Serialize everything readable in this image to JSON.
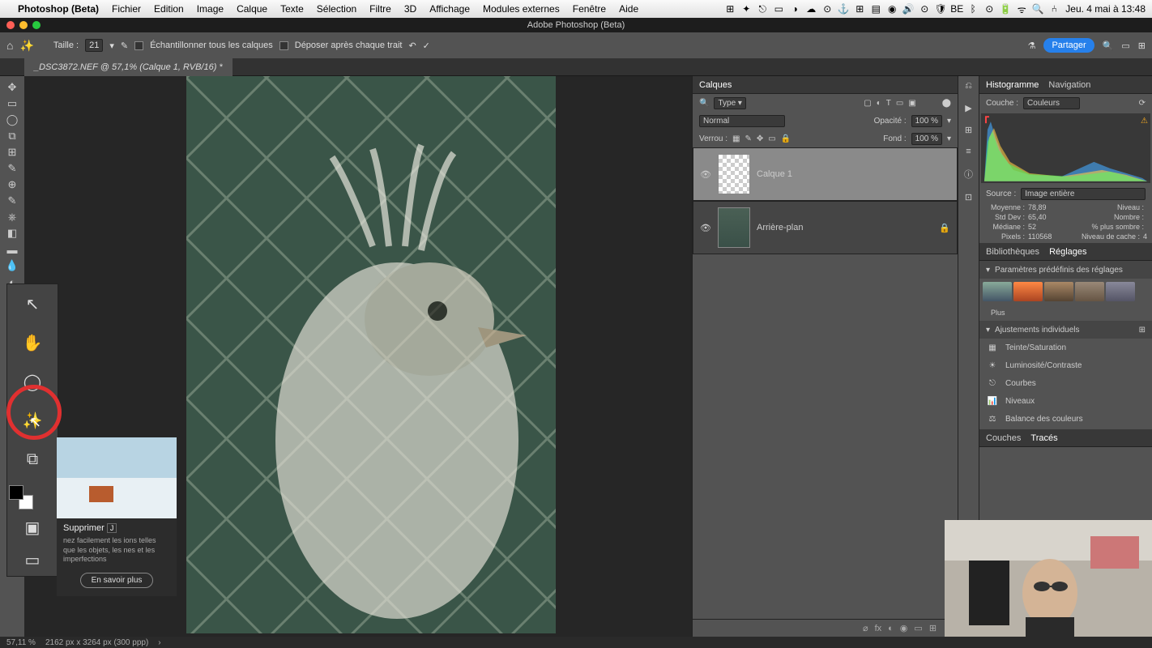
{
  "macmenu": {
    "app": "Photoshop (Beta)",
    "items": [
      "Fichier",
      "Edition",
      "Image",
      "Calque",
      "Texte",
      "Sélection",
      "Filtre",
      "3D",
      "Affichage",
      "Modules externes",
      "Fenêtre",
      "Aide"
    ],
    "clock": "Jeu. 4 mai à 13:48"
  },
  "titlebar": "Adobe Photoshop (Beta)",
  "optbar": {
    "size_label": "Taille :",
    "size_val": "21",
    "sample_label": "Échantillonner tous les calques",
    "drop_label": "Déposer après chaque trait",
    "share": "Partager"
  },
  "doc_tab": "_DSC3872.NEF @ 57,1% (Calque 1, RVB/16) *",
  "layers_panel": {
    "tab": "Calques",
    "filter_label": "Type",
    "blend": "Normal",
    "opacity_label": "Opacité :",
    "opacity_val": "100 %",
    "lock_label": "Verrou :",
    "fill_label": "Fond :",
    "fill_val": "100 %",
    "layers": [
      {
        "name": "Calque 1",
        "visible": true,
        "selected": true,
        "checker": true
      },
      {
        "name": "Arrière-plan",
        "visible": true,
        "selected": false,
        "locked": true
      }
    ]
  },
  "hist_panel": {
    "tabs": [
      "Histogramme",
      "Navigation"
    ],
    "channel_label": "Couche :",
    "channel_val": "Couleurs",
    "source_label": "Source :",
    "source_val": "Image entière",
    "stats": {
      "moyenne_l": "Moyenne :",
      "moyenne": "78,89",
      "stddev_l": "Std Dev :",
      "stddev": "65,40",
      "mediane_l": "Médiane :",
      "mediane": "52",
      "pixels_l": "Pixels :",
      "pixels": "110568",
      "niveau_l": "Niveau :",
      "nombre_l": "Nombre :",
      "sombre_l": "% plus sombre :",
      "cache_l": "Niveau de cache :",
      "cache": "4"
    }
  },
  "lib_panel": {
    "tabs": [
      "Bibliothèques",
      "Réglages"
    ],
    "presets_label": "Paramètres prédéfinis des réglages",
    "more": "Plus",
    "adj_label": "Ajustements individuels",
    "adjustments": [
      "Teinte/Saturation",
      "Luminosité/Contraste",
      "Courbes",
      "Niveaux",
      "Balance des couleurs"
    ]
  },
  "paths_panel": {
    "tabs": [
      "Couches",
      "Tracés"
    ]
  },
  "tooltip": {
    "title": "Supprimer",
    "shortcut": "J",
    "desc": "nez facilement les ions telles que les objets, les nes et les imperfections",
    "btn": "En savoir plus"
  },
  "statusbar": {
    "zoom": "57,11 %",
    "dims": "2162 px x 3264 px (300 ppp)"
  }
}
